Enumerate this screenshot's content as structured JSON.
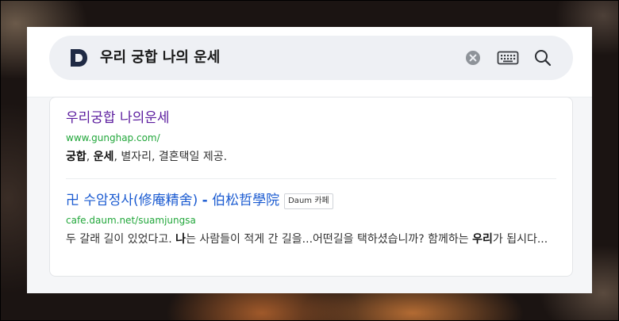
{
  "search": {
    "query": "우리 궁합 나의 운세",
    "logo_letter": "D"
  },
  "results": [
    {
      "title": "우리궁합 나의운세",
      "url": "www.gunghap.com/",
      "snippet_parts": [
        {
          "text": "궁합",
          "bold": true
        },
        {
          "text": ", ",
          "bold": false
        },
        {
          "text": "운세",
          "bold": true
        },
        {
          "text": ", 별자리, 결혼택일 제공.",
          "bold": false
        }
      ],
      "visited": true
    },
    {
      "title_parts": [
        {
          "text": "卍 수암정사(修庵精舍) ",
          "bold": false
        },
        {
          "text": "-",
          "bold": true
        },
        {
          "text": " 伯松哲學院",
          "bold": false
        }
      ],
      "badge": "Daum 카페",
      "url": "cafe.daum.net/suamjungsa",
      "snippet_parts": [
        {
          "text": "두 갈래 길이 있었다고. ",
          "bold": false
        },
        {
          "text": "나",
          "bold": true
        },
        {
          "text": "는 사람들이 적게 간 길을...어떤길을 택하셨습니까? 함께하는 ",
          "bold": false
        },
        {
          "text": "우리",
          "bold": true
        },
        {
          "text": "가 됩시다...",
          "bold": false
        }
      ],
      "visited": false
    }
  ],
  "colors": {
    "visited_title": "#5b1c9e",
    "link_title": "#1b5bd1",
    "url_green": "#22a73b",
    "logo_navy": "#1f2a44"
  },
  "icons": [
    "daum-logo-icon",
    "clear-icon",
    "keyboard-icon",
    "search-icon"
  ]
}
